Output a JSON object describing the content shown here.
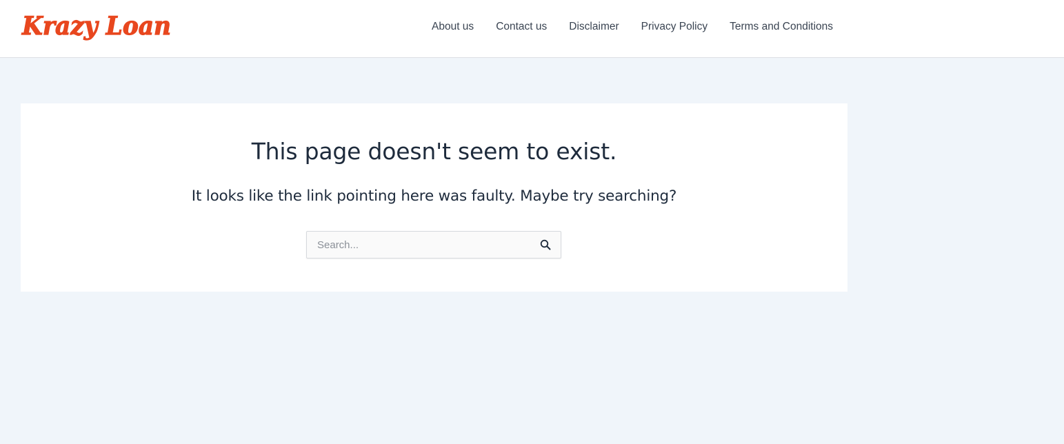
{
  "header": {
    "logo_text": "Krazy Loan",
    "nav": [
      {
        "label": "About us"
      },
      {
        "label": "Contact us"
      },
      {
        "label": "Disclaimer"
      },
      {
        "label": "Privacy Policy"
      },
      {
        "label": "Terms and Conditions"
      }
    ]
  },
  "main": {
    "title": "This page doesn't seem to exist.",
    "message": "It looks like the link pointing here was faulty. Maybe try searching?",
    "search": {
      "placeholder": "Search...",
      "value": "",
      "icon": "search-icon"
    }
  },
  "colors": {
    "logo": "#e8471e",
    "page_background": "#f0f5fa",
    "text": "#1e2b3c"
  }
}
